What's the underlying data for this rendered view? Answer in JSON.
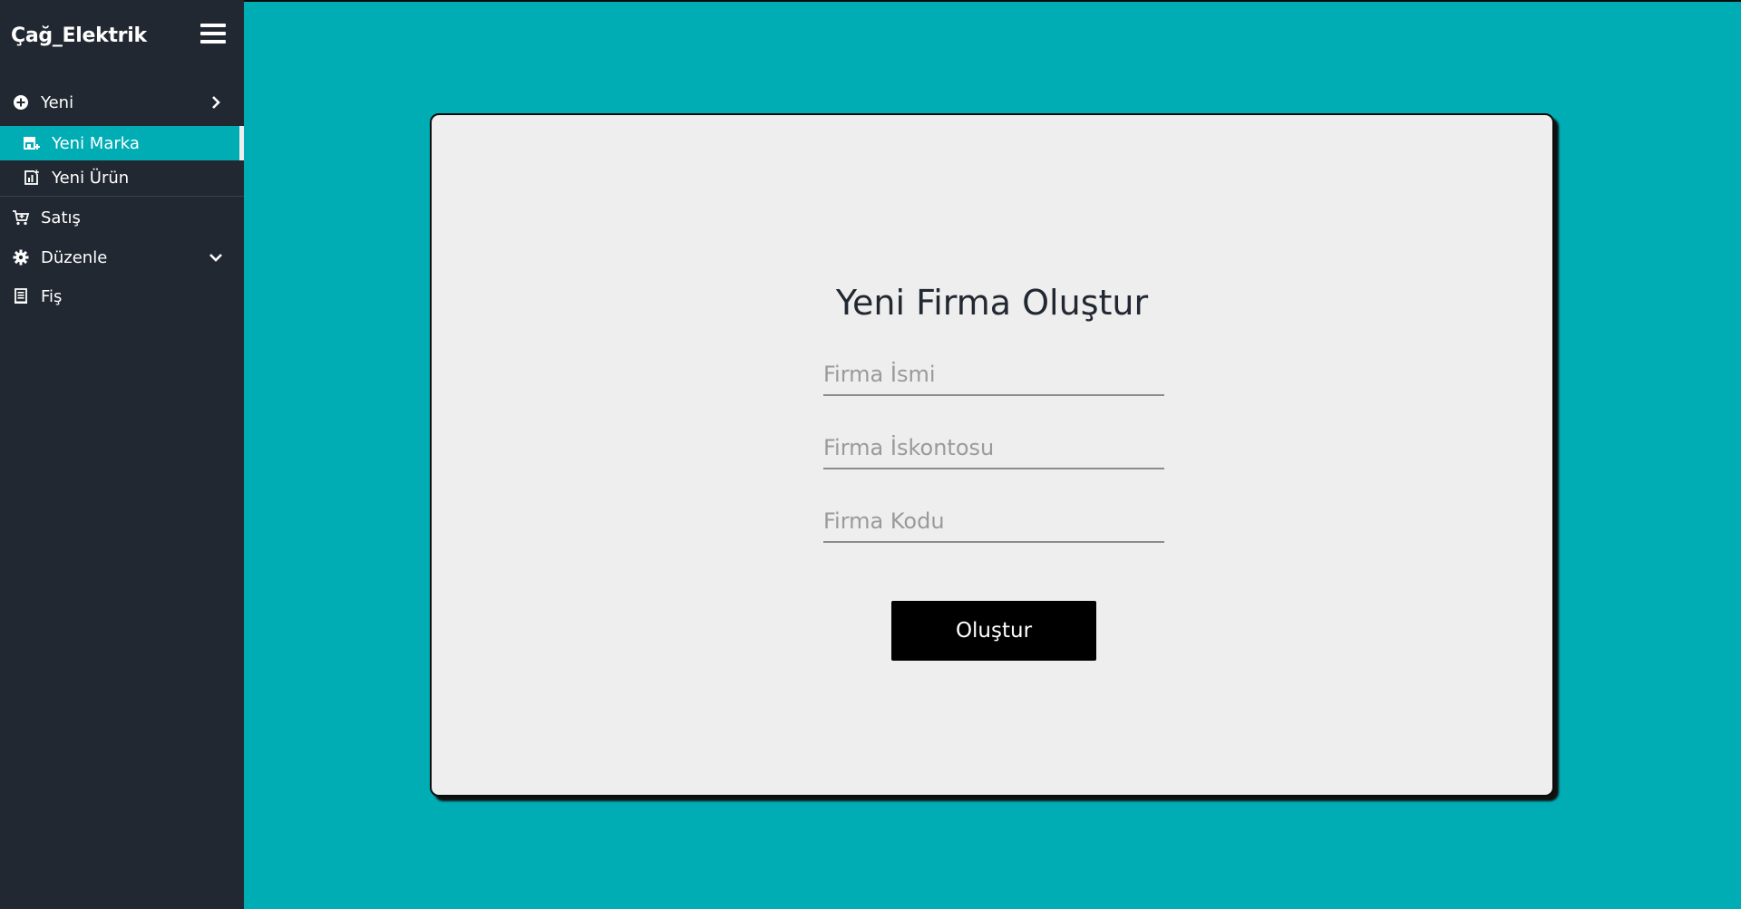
{
  "app": {
    "brand": "Çağ_Elektrik"
  },
  "colors": {
    "accent": "#00adb5",
    "sidebar": "#222831",
    "card": "#eeeeee",
    "button": "#000000"
  },
  "sidebar": {
    "items": [
      {
        "label": "Yeni",
        "icon": "plus-circle-icon",
        "caret": "chevron-right-icon"
      },
      {
        "label": "Yeni Marka",
        "icon": "store-icon",
        "active": true
      },
      {
        "label": "Yeni Ürün",
        "icon": "chart-icon"
      },
      {
        "label": "Satış",
        "icon": "cart-icon"
      },
      {
        "label": "Düzenle",
        "icon": "gear-icon",
        "caret": "chevron-down-icon"
      },
      {
        "label": "Fiş",
        "icon": "receipt-icon"
      }
    ]
  },
  "form": {
    "title": "Yeni Firma Oluştur",
    "fields": [
      {
        "placeholder": "Firma İsmi",
        "value": ""
      },
      {
        "placeholder": "Firma İskontosu",
        "value": ""
      },
      {
        "placeholder": "Firma Kodu",
        "value": ""
      }
    ],
    "submit_label": "Oluştur"
  }
}
